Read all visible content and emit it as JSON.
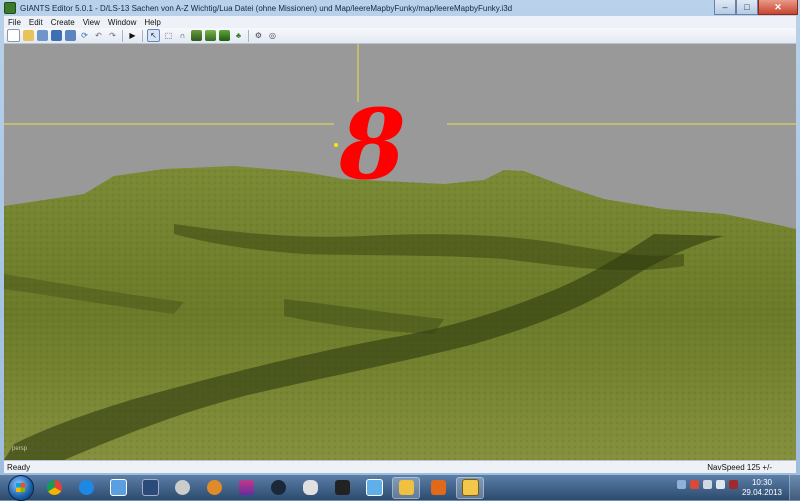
{
  "window": {
    "title": "GIANTS Editor 5.0.1 - D/LS-13 Sachen von A-Z Wichtig/Lua Datei (ohne Missionen) und Map/leereMapbyFunky/map/leereMapbyFunky.i3d",
    "minimize_label": "–",
    "maximize_label": "□",
    "close_label": "✕"
  },
  "menu": {
    "items": [
      "File",
      "Edit",
      "Create",
      "View",
      "Window",
      "Help"
    ]
  },
  "toolbar": {
    "icons": [
      "new-icon",
      "open-icon",
      "import-icon",
      "save-icon",
      "save-as-icon",
      "refresh-icon",
      "undo-icon",
      "redo-icon",
      "play-icon",
      "select-icon",
      "move-icon",
      "paint-icon",
      "terrain-icon",
      "foliage-icon",
      "settings-icon",
      "target-icon"
    ]
  },
  "viewport": {
    "camera_label": "persp",
    "sky_color": "#999999",
    "terrain_color": "#6f7d2c",
    "gizmo_color": "#ff0000"
  },
  "status": {
    "left": "Ready",
    "right": "NavSpeed 125 +/-"
  },
  "taskbar": {
    "apps": [
      "chrome-icon",
      "ie-icon",
      "explorer-icon",
      "monitor-icon",
      "puzzle-icon",
      "media-player-icon",
      "winrar-icon",
      "steam-icon",
      "gamepad-icon",
      "notepad-icon",
      "folder-icon",
      "mail-icon",
      "giants-editor-icon"
    ],
    "clock_time": "10:30",
    "clock_date": "29.04.2013"
  }
}
